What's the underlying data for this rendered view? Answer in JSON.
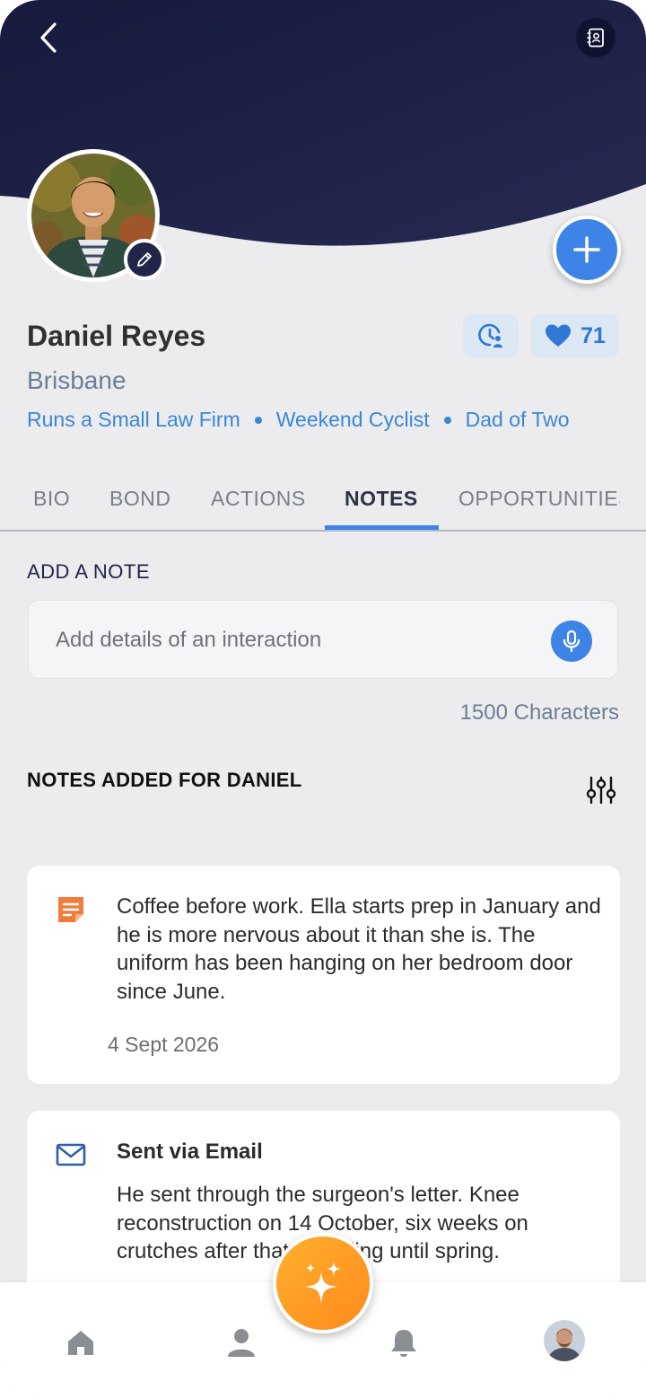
{
  "header": {
    "back_icon": "chevron-left-icon",
    "contact_icon": "contact-book-icon",
    "bg_color": "#1a1d3f"
  },
  "profile": {
    "name": "Daniel Reyes",
    "location": "Brisbane",
    "tags": [
      "Runs a Small Law Firm",
      "Weekend Cyclist",
      "Dad of Two"
    ],
    "like_count": "71",
    "edit_icon": "pencil-icon",
    "add_icon": "plus-icon",
    "history_icon": "clock-person-icon",
    "like_icon": "heart-icon"
  },
  "tabs": {
    "items": [
      "BIO",
      "BOND",
      "ACTIONS",
      "NOTES",
      "OPPORTUNITIES"
    ],
    "active": "NOTES"
  },
  "add_note": {
    "label": "ADD A NOTE",
    "placeholder": "Add details of an interaction",
    "char_limit": "1500 Characters",
    "mic_icon": "microphone-icon"
  },
  "notes_section": {
    "title": "NOTES ADDED FOR DANIEL",
    "filter_icon": "sliders-icon",
    "notes": [
      {
        "icon": "note-icon",
        "text": "Coffee before work. Ella starts prep in January and he is more nervous about it than she is. The uniform has been hanging on her bedroom door since June.",
        "date": "4 Sept 2026"
      },
      {
        "icon": "envelope-icon",
        "title": "Sent via Email",
        "text": "He sent through the surgeon's letter. Knee reconstruction on 14 October, six weeks on crutches after that, no riding until spring."
      }
    ]
  },
  "bottom_nav": {
    "items": [
      "home-icon",
      "person-icon",
      "bell-icon",
      "user-avatar"
    ],
    "fab_icon": "sparkles-icon"
  },
  "colors": {
    "accent": "#3d84e6",
    "tag": "#3a87d6",
    "fab": "#ff9a22",
    "note_icon": "#f07b3a"
  }
}
